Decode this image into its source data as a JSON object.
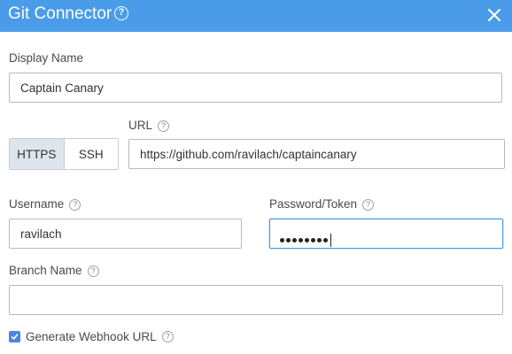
{
  "dialog": {
    "title": "Git Connector",
    "help_icon": "help-circle-icon",
    "close_icon": "close-icon"
  },
  "fields": {
    "display_name": {
      "label": "Display Name",
      "value": "Captain Canary"
    },
    "url": {
      "label": "URL",
      "value": "https://github.com/ravilach/captaincanary"
    },
    "protocol": {
      "options": [
        "HTTPS",
        "SSH"
      ],
      "selected": "HTTPS"
    },
    "username": {
      "label": "Username",
      "value": "ravilach"
    },
    "password": {
      "label": "Password/Token",
      "masked_length": 8
    },
    "branch_name": {
      "label": "Branch Name",
      "value": ""
    },
    "generate_webhook": {
      "label": "Generate Webhook URL",
      "checked": true
    }
  },
  "colors": {
    "header_bg": "#4a9ce8",
    "checkbox": "#4a86e0",
    "toggle_active_bg": "#dfe5ec"
  }
}
